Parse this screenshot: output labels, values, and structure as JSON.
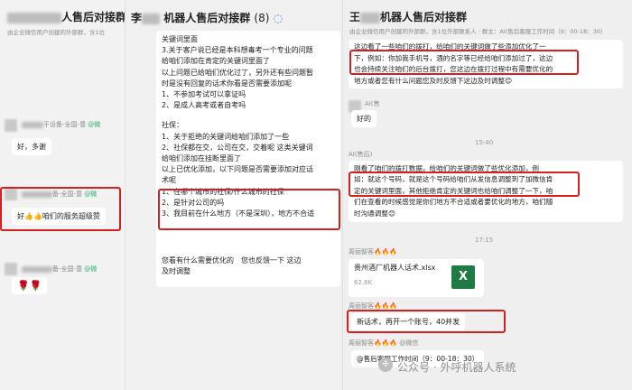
{
  "pane1": {
    "title": "人售后对接群",
    "subtitle": "由企业微信用户创建的外部群，含1位",
    "sender1_suffix": "干设备-全国-",
    "sender1_tag": "豊",
    "sender1_badge": "@微",
    "msg1": "好，多谢",
    "sender2_suffix": "备-全国-",
    "sender2_tag": "豊",
    "sender2_badge": "@微",
    "msg2": "咱们的服务超级赞",
    "msg2_prefix": "好",
    "sender3_suffix": "备-全国-",
    "sender3_tag": "豊",
    "sender3_badge": "@微",
    "msg3": "🌹🌹"
  },
  "pane2": {
    "title_prefix": "李",
    "title": "机器人售后对接群",
    "count": "(8)",
    "lines_top": [
      "关键词里面",
      "3.关于客户说已经是本科想毒考一个专业的问题",
      "给咱们添加在肯定的关键词里面了",
      "以上问题已给咱们优化过了，另外还有些问题暂",
      "时是没有回复的话术你看是否需要添加呢",
      "1、不参加考试可以拿证吗",
      "2、是成人高考或者自考吗"
    ],
    "lines_mid": [
      "社保：",
      "1、关于拒绝的关键词给咱们添加了一些",
      "2、社保都在交，公司在交，交着呢 这类关键词",
      "给咱们添加在挂断里面了",
      "以上已优化添加，以下问题是否需要添加对应话",
      "术呢"
    ],
    "lines_box": [
      "1、在哪个城市的社保/什么城市的社保",
      "2、是针对公司的吗",
      "3、我目前在什么地方（不是深圳），地方不合适"
    ],
    "lines_bottom": [
      "您看有什么需要优化的　您也反馈一下 这边",
      "及时调整"
    ]
  },
  "pane3": {
    "title_prefix": "王",
    "title": "机器人售后对接群",
    "subtitle": "由企业微信用户创建的外部群，含1位外部联系人 · 群主：AI(售后客服工作时间（9：00-18：30）",
    "msg1_lines": [
      "这边看了一些咱们的拨打，给咱们的关键词做了些添加优化了一",
      "下，例如：你加我手机号，酒的名字等已经给咱们添加过了，这边",
      "也会持续关注咱们的后台拨打，您这边在拨打过程中有需要优化的",
      "地方或者您有什么问题您及时反馈下这边及时调整"
    ],
    "msg1_emoji": "😊",
    "sender_ai_name": "AI(售",
    "reply1": "好的",
    "time1": "15:40",
    "sender_ai2": "AI(售后)",
    "msg2_lines": [
      "刚看了咱们的拨打数据，给咱们的关键词做了些优化添加，例",
      "如：就这个号码，就是这个号码给咱们从发信息调整到了加微信肯",
      "定的关键词里面，其他拒绝肯定的关键词也给咱们调整了一下，咱",
      "们在查看的时候感觉是你们地方不合适或者要优化的地方，咱们随",
      "时沟通调整"
    ],
    "msg2_emoji": "😊",
    "time2": "17:15",
    "sender_zhou1": "周丽智客🔥🔥🔥",
    "file_name": "贵州酒厂机器人话术.xlsx",
    "file_size": "62.6K",
    "file_icon": "X",
    "sender_zhou2": "周丽智客🔥🔥🔥",
    "msg3": "新话术，再开一个账号，40并发",
    "sender_zhou3": "周丽智客🔥🔥🔥 @微信",
    "msg4_prefix": "@售后客服工作时间（9：00-18：30）",
    "watermark": "公众号 · 外呼机器人系统"
  }
}
